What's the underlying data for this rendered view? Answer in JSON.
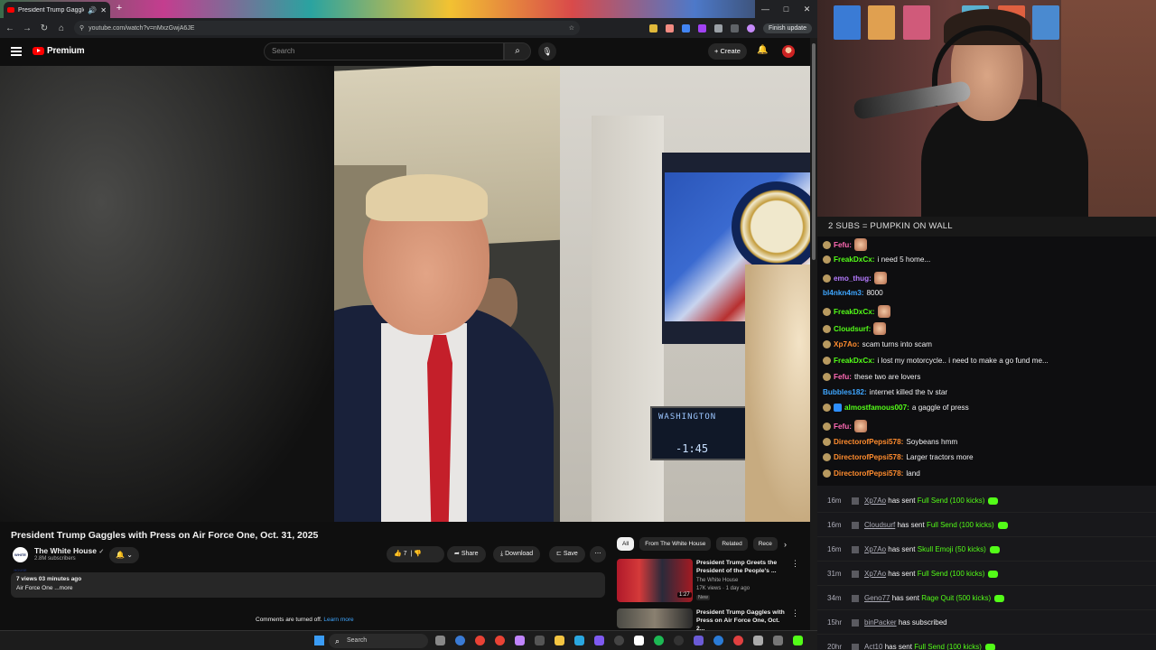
{
  "browser": {
    "tab_title": "President Trump Gaggles w",
    "url": "youtube.com/watch?v=nMxzGwjA6JE",
    "finish_update": "Finish update",
    "new_tab": "+",
    "window_controls": [
      "—",
      "□",
      "✕"
    ]
  },
  "youtube": {
    "logo_text": "Premium",
    "search_placeholder": "Search",
    "create_label": "Create",
    "video_title": "President Trump Gaggles with Press on Air Force One, Oct. 31, 2025",
    "channel_name": "The White House",
    "channel_subs": "2.8M subscribers",
    "channel_logo_text": "WHITE HOUSE",
    "like_count": "7",
    "share_label": "Share",
    "download_label": "Download",
    "save_label": "Save",
    "description_views": "7 views  03 minutes ago",
    "description_text": "Air Force One ...more",
    "comments_off": "Comments are turned off.",
    "learn_more": "Learn more",
    "chips": [
      "All",
      "From The White House",
      "Related",
      "Rece"
    ],
    "related": [
      {
        "title": "President Trump Greets the President of the People's ...",
        "channel": "The White House",
        "meta": "17K views · 1 day ago",
        "badge": "New",
        "duration": "1:27"
      },
      {
        "title": "President Trump Gaggles with Press on Air Force One, Oct. 2...",
        "channel": "",
        "meta": "",
        "badge": "",
        "duration": ""
      }
    ]
  },
  "video_overlay": {
    "clock_city": "WASHINGTON",
    "clock_time": "-1:45"
  },
  "chat": {
    "banner": "2 SUBS = PUMPKIN ON WALL",
    "messages": [
      {
        "user": "Fefu:",
        "text": "",
        "color": "#ff69b4",
        "emote": true,
        "badge": "b"
      },
      {
        "user": "FreakDxCx:",
        "text": "i need 5 home...",
        "color": "#53fc18",
        "emote": false,
        "badge": "b"
      },
      {
        "user": "emo_thug:",
        "text": "",
        "color": "#b57bff",
        "emote": true,
        "badge": "b"
      },
      {
        "user": "bl4nkn4m3:",
        "text": "8000",
        "color": "#3ea6ff",
        "emote": false,
        "badge": ""
      },
      {
        "user": "FreakDxCx:",
        "text": "",
        "color": "#53fc18",
        "emote": true,
        "badge": "b"
      },
      {
        "user": "Cloudsurf:",
        "text": "",
        "color": "#53fc18",
        "emote": true,
        "badge": "b"
      },
      {
        "user": "Xp7Ao:",
        "text": "scam turns into scam",
        "color": "#ff8c2e",
        "emote": false,
        "badge": "b"
      },
      {
        "user": "FreakDxCx:",
        "text": "i lost my motorcycle.. i need to make a go fund me...",
        "color": "#53fc18",
        "emote": false,
        "badge": "b"
      },
      {
        "user": "Fefu:",
        "text": "these two are lovers",
        "color": "#ff69b4",
        "emote": false,
        "badge": "b"
      },
      {
        "user": "Bubbles182:",
        "text": "internet killed the tv star",
        "color": "#3ea6ff",
        "emote": false,
        "badge": ""
      },
      {
        "user": "almostfamous007:",
        "text": "a gaggle of press",
        "color": "#53fc18",
        "emote": false,
        "badge": "bc"
      },
      {
        "user": "Fefu:",
        "text": "",
        "color": "#ff69b4",
        "emote": true,
        "badge": "b"
      },
      {
        "user": "DirectorofPepsi578:",
        "text": "Soybeans hmm",
        "color": "#ff8c2e",
        "emote": false,
        "badge": "b"
      },
      {
        "user": "DirectorofPepsi578:",
        "text": "Larger tractors more",
        "color": "#ff8c2e",
        "emote": false,
        "badge": "b"
      },
      {
        "user": "DirectorofPepsi578:",
        "text": "land",
        "color": "#ff8c2e",
        "emote": false,
        "badge": "b"
      }
    ]
  },
  "events": [
    {
      "time": "16m",
      "user": "Xp7Ao",
      "action": "has sent",
      "item": "Full Send (100 kicks)",
      "gem": true
    },
    {
      "time": "16m",
      "user": "Cloudsurf",
      "action": "has sent",
      "item": "Full Send (100 kicks)",
      "gem": true
    },
    {
      "time": "16m",
      "user": "Xp7Ao",
      "action": "has sent",
      "item": "Skull Emoji (50 kicks)",
      "gem": true
    },
    {
      "time": "31m",
      "user": "Xp7Ao",
      "action": "has sent",
      "item": "Full Send (100 kicks)",
      "gem": true
    },
    {
      "time": "34m",
      "user": "Geno77",
      "action": "has sent",
      "item": "Rage Quit (500 kicks)",
      "gem": true
    },
    {
      "time": "15hr",
      "user": "binPacker",
      "action": "has subscribed",
      "item": "",
      "gem": false
    },
    {
      "time": "20hr",
      "user": "Act10",
      "action": "has sent",
      "item": "Full Send (100 kicks)",
      "gem": true
    }
  ],
  "taskbar": {
    "search_label": "Search"
  }
}
